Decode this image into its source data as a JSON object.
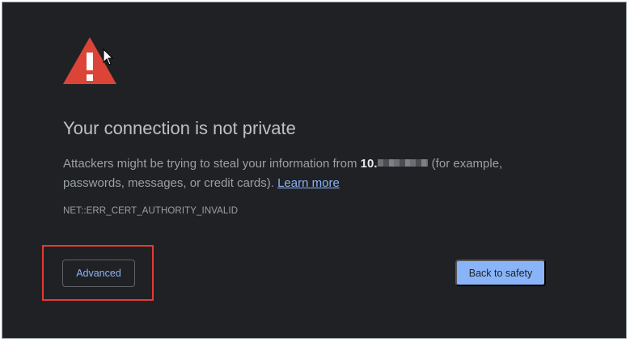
{
  "page": {
    "warning_icon": "warning-triangle-icon",
    "cursor_icon": "mouse-pointer-icon",
    "title": "Your connection is not private",
    "message": {
      "prefix": "Attackers might be trying to steal your information from ",
      "host": "10.",
      "suffix": " (for example, passwords, messages, or credit cards). ",
      "learn_more": "Learn more"
    },
    "error_code": "NET::ERR_CERT_AUTHORITY_INVALID",
    "advanced_label": "Advanced",
    "back_to_safety_label": "Back to safety"
  },
  "colors": {
    "background": "#202124",
    "warning_red": "#db4437",
    "link_blue": "#8ab4f8",
    "highlight_red": "#e53935"
  }
}
